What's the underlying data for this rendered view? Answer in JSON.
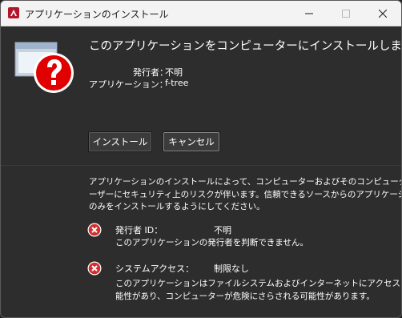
{
  "window": {
    "title": "アプリケーションのインストール"
  },
  "main": {
    "question": "このアプリケーションをコンピューターにインストールしますか？",
    "publisher_label": "発行者：",
    "publisher_value": "不明",
    "app_label": "アプリケーション：",
    "app_value": "f-tree"
  },
  "buttons": {
    "install": "インストール",
    "cancel": "キャンセル"
  },
  "notice": {
    "line1": "アプリケーションのインストールによって、コンピューターおよびそのコンピューターのユ",
    "line2": "ーザーにセキュリティ上のリスクが伴います。信頼できるソースからのアプリケーション",
    "line3": "のみをインストールするようにしてください。"
  },
  "warnings": [
    {
      "icon": "error-icon",
      "label": "発行者 ID：",
      "value": "不明",
      "desc_lines": [
        "このアプリケーションの発行者を判断できません。"
      ]
    },
    {
      "icon": "error-icon",
      "label": "システムアクセス：",
      "value": "制限なし",
      "desc_lines": [
        "このアプリケーションはファイルシステムおよびインターネットにアクセスする可",
        "能性があり、コンピューターが危険にさらされる可能性があります。"
      ]
    }
  ],
  "colors": {
    "dialog_bg": "#2d2d2d",
    "titlebar_bg": "#f3f3f3",
    "error_red": "#d32f2f",
    "big_icon_red": "#e10000"
  }
}
